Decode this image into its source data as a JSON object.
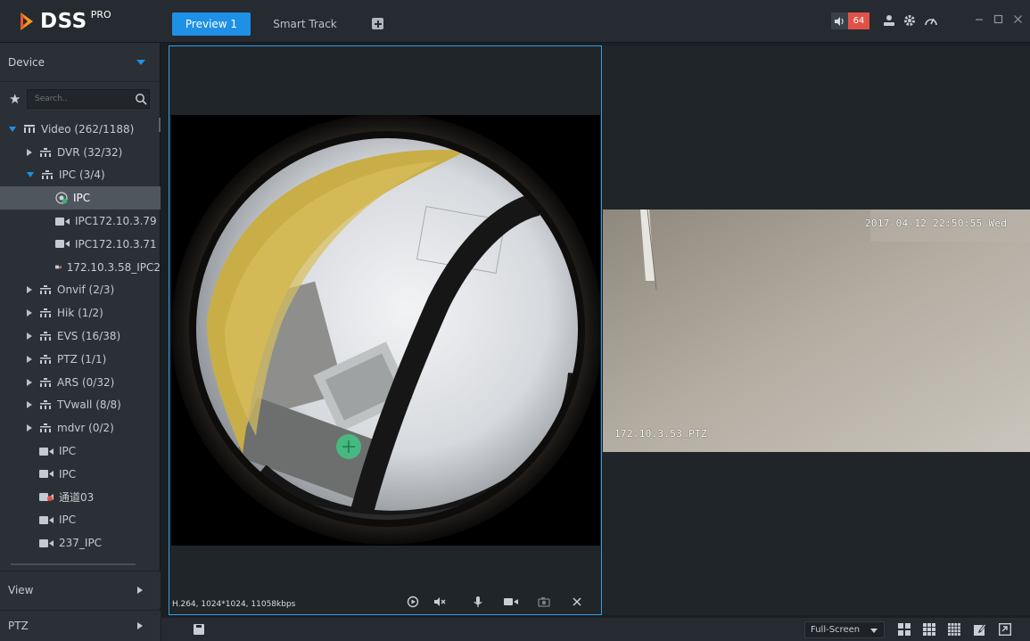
{
  "app": {
    "logo_text": "DSS",
    "logo_sup": "PRO"
  },
  "tabs": [
    {
      "label": "Preview 1",
      "active": true
    },
    {
      "label": "Smart Track",
      "active": false
    }
  ],
  "header": {
    "alarm_count": "64"
  },
  "sidebar": {
    "device_label": "Device",
    "search_placeholder": "Search..",
    "tree": [
      {
        "label": "Video (262/1188)",
        "level": 0,
        "expand": "down",
        "icon": "network-icon"
      },
      {
        "label": "DVR (32/32)",
        "level": 1,
        "expand": "right",
        "icon": "network-icon"
      },
      {
        "label": "IPC (3/4)",
        "level": 1,
        "expand": "down",
        "icon": "network-icon"
      },
      {
        "label": "IPC",
        "level": 2,
        "icon": "fisheye-camera-icon",
        "selected": true
      },
      {
        "label": "IPC172.10.3.79",
        "level": 2,
        "icon": "camera-icon"
      },
      {
        "label": "IPC172.10.3.71",
        "level": 2,
        "icon": "camera-icon"
      },
      {
        "label": "172.10.3.58_IPC2",
        "level": 2,
        "icon": "camera-offline-icon"
      },
      {
        "label": "Onvif (2/3)",
        "level": 1,
        "expand": "right",
        "icon": "network-icon"
      },
      {
        "label": "Hik (1/2)",
        "level": 1,
        "expand": "right",
        "icon": "network-icon"
      },
      {
        "label": "EVS (16/38)",
        "level": 1,
        "expand": "right",
        "icon": "network-icon"
      },
      {
        "label": "PTZ (1/1)",
        "level": 1,
        "expand": "right",
        "icon": "network-icon"
      },
      {
        "label": "ARS (0/32)",
        "level": 1,
        "expand": "right",
        "icon": "network-icon"
      },
      {
        "label": "TVwall (8/8)",
        "level": 1,
        "expand": "right",
        "icon": "network-icon"
      },
      {
        "label": "mdvr (0/2)",
        "level": 1,
        "expand": "right",
        "icon": "network-icon"
      },
      {
        "label": "IPC",
        "level": 1,
        "icon": "camera-icon"
      },
      {
        "label": "IPC",
        "level": 1,
        "icon": "camera-icon"
      },
      {
        "label": "通道03",
        "level": 1,
        "icon": "camera-offline-icon"
      },
      {
        "label": "IPC",
        "level": 1,
        "icon": "camera-icon"
      },
      {
        "label": "237_IPC",
        "level": 1,
        "icon": "camera-icon"
      }
    ],
    "view_label": "View",
    "ptz_label": "PTZ"
  },
  "video": {
    "left_caption": "H.264, 1024*1024, 11058kbps",
    "right_timestamp": "2017-04-12 22:50:55 Wed",
    "right_channel": "172.10.3.53_PTZ"
  },
  "bottom": {
    "fullscreen_label": "Full-Screen"
  },
  "colors": {
    "accent": "#1e90e6",
    "alarm": "#e05248",
    "selected_pane_border": "#2f9fe8"
  }
}
